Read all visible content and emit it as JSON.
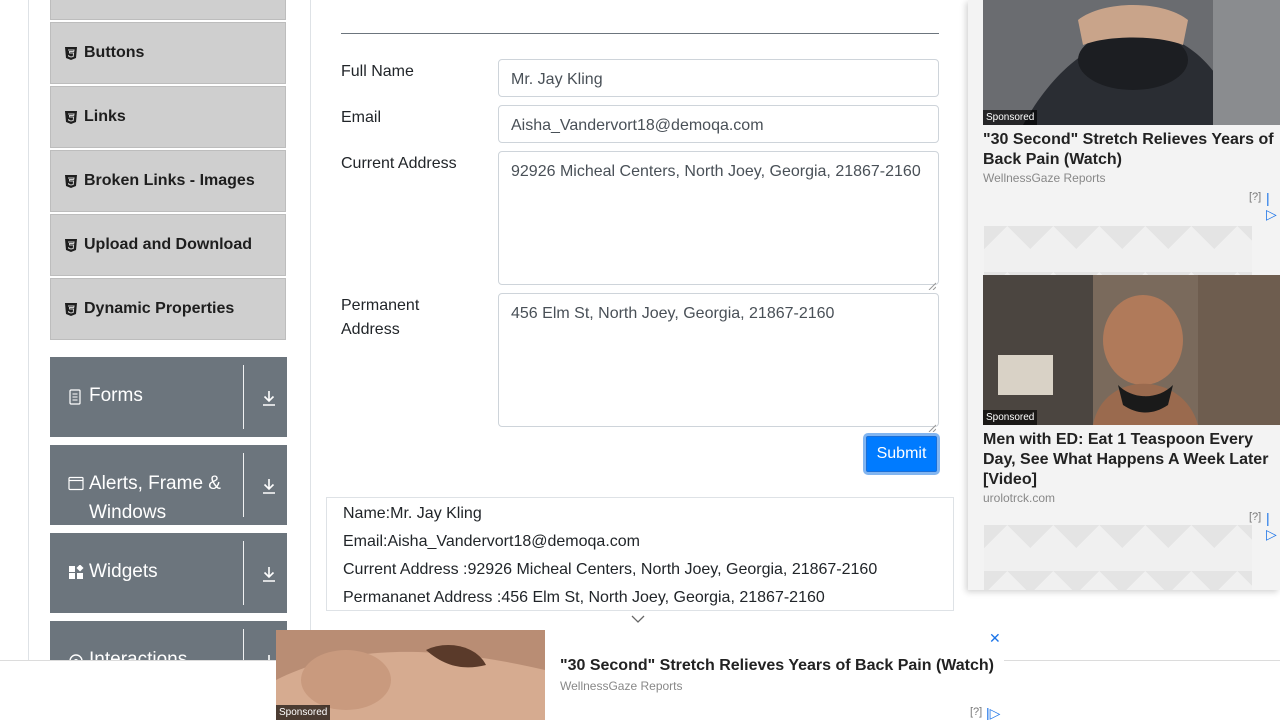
{
  "sidebar": {
    "elements_items": [
      {
        "label": "Buttons"
      },
      {
        "label": "Links"
      },
      {
        "label": "Broken Links - Images"
      },
      {
        "label": "Upload and Download"
      },
      {
        "label": "Dynamic Properties"
      }
    ],
    "groups": [
      {
        "label": "Forms",
        "icon": "document-icon"
      },
      {
        "label": "Alerts, Frame & Windows",
        "icon": "window-icon"
      },
      {
        "label": "Widgets",
        "icon": "widgets-icon"
      },
      {
        "label": "Interactions",
        "icon": "interactions-icon"
      }
    ],
    "accent_color": "#6c757d"
  },
  "form": {
    "full_name_label": "Full Name",
    "full_name_value": "Mr. Jay Kling",
    "email_label": "Email",
    "email_value": "Aisha_Vandervort18@demoqa.com",
    "current_address_label": "Current Address",
    "current_address_value": "92926 Micheal Centers, North Joey, Georgia, 21867-2160",
    "permanent_address_label": "Permanent Address",
    "permanent_address_value": "456 Elm St, North Joey, Georgia, 21867-2160",
    "submit_label": "Submit",
    "submit_color": "#007bff"
  },
  "output": {
    "name": "Name:Mr. Jay Kling",
    "email": "Email:Aisha_Vandervort18@demoqa.com",
    "current_address": "Current Address :92926 Micheal Centers, North Joey, Georgia, 21867-2160",
    "permanent_address": "Permananet Address :456 Elm St, North Joey, Georgia, 21867-2160"
  },
  "ads": {
    "right_1": {
      "sponsored": "Sponsored",
      "title": "\"30 Second\" Stretch Relieves Years of Back Pain (Watch)",
      "source": "WellnessGaze Reports",
      "info": "[?]"
    },
    "right_2": {
      "sponsored": "Sponsored",
      "title": "Men with ED: Eat 1 Teaspoon Every Day, See What Happens A Week Later [Video]",
      "source": "urolotrck.com",
      "info": "[?]"
    },
    "bottom": {
      "sponsored": "Sponsored",
      "title": "\"30 Second\" Stretch Relieves Years of Back Pain (Watch)",
      "source": "WellnessGaze Reports",
      "info": "[?]"
    }
  }
}
